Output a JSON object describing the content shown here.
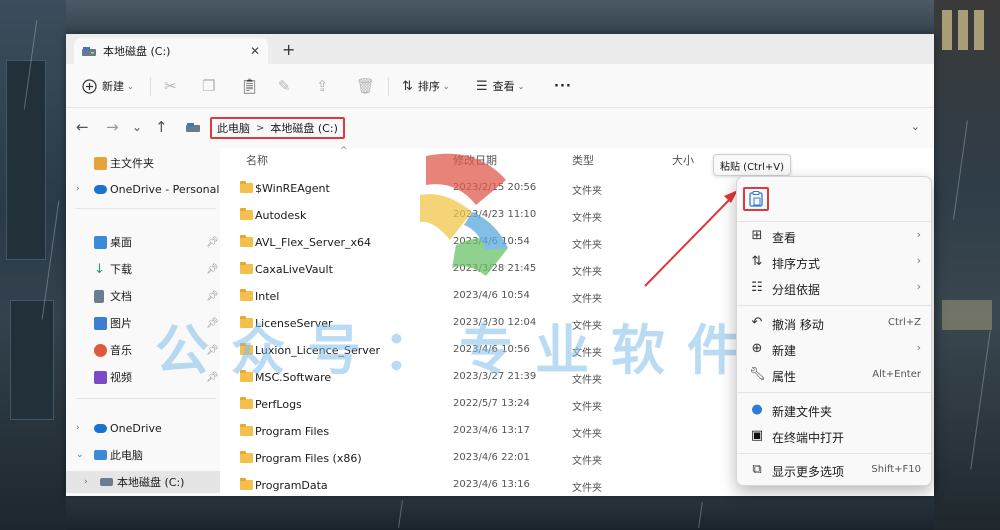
{
  "window": {
    "tab_title": "本地磁盘 (C:)",
    "tab_close": "✕",
    "new_tab": "+"
  },
  "toolbar": {
    "new_label": "新建",
    "sort_label": "排序",
    "view_label": "查看",
    "more": "···"
  },
  "address": {
    "crumbs": [
      "此电脑",
      "本地磁盘 (C:)"
    ],
    "sep": ">"
  },
  "sidebar": {
    "items": [
      {
        "label": "主文件夹",
        "icon": "home-icon",
        "color": "#e8a23a"
      },
      {
        "label": "OneDrive - Personal",
        "icon": "cloud-icon",
        "color": "#1a73d1"
      },
      {
        "label": "桌面",
        "icon": "desktop-icon",
        "color": "#3a8ad6"
      },
      {
        "label": "下载",
        "icon": "download-icon",
        "color": "#2a9a6a"
      },
      {
        "label": "文档",
        "icon": "document-icon",
        "color": "#6a7d90"
      },
      {
        "label": "图片",
        "icon": "picture-icon",
        "color": "#3c7fd0"
      },
      {
        "label": "音乐",
        "icon": "music-icon",
        "color": "#e0593b"
      },
      {
        "label": "视频",
        "icon": "video-icon",
        "color": "#7a4ac8"
      },
      {
        "label": "OneDrive",
        "icon": "cloud-icon",
        "color": "#1a73d1"
      },
      {
        "label": "此电脑",
        "icon": "computer-icon",
        "color": "#3a8ad6"
      },
      {
        "label": "本地磁盘 (C:)",
        "icon": "drive-icon",
        "color": "#6a7d90"
      }
    ]
  },
  "list": {
    "headers": {
      "name": "名称",
      "date": "修改日期",
      "type": "类型",
      "size": "大小"
    },
    "rows": [
      {
        "name": "$WinREAgent",
        "date": "2023/2/15 20:56",
        "type": "文件夹"
      },
      {
        "name": "Autodesk",
        "date": "2023/4/23 11:10",
        "type": "文件夹"
      },
      {
        "name": "AVL_Flex_Server_x64",
        "date": "2023/4/6 10:54",
        "type": "文件夹"
      },
      {
        "name": "CaxaLiveVault",
        "date": "2023/3/28 21:45",
        "type": "文件夹"
      },
      {
        "name": "Intel",
        "date": "2023/4/6 10:54",
        "type": "文件夹"
      },
      {
        "name": "LicenseServer",
        "date": "2023/3/30 12:04",
        "type": "文件夹"
      },
      {
        "name": "Luxion_Licence_Server",
        "date": "2023/4/6 10:56",
        "type": "文件夹"
      },
      {
        "name": "MSC.Software",
        "date": "2023/3/27 21:39",
        "type": "文件夹"
      },
      {
        "name": "PerfLogs",
        "date": "2022/5/7 13:24",
        "type": "文件夹"
      },
      {
        "name": "Program Files",
        "date": "2023/4/6 13:17",
        "type": "文件夹"
      },
      {
        "name": "Program Files (x86)",
        "date": "2023/4/6 22:01",
        "type": "文件夹"
      },
      {
        "name": "ProgramData",
        "date": "2023/4/6 13:16",
        "type": "文件夹"
      }
    ]
  },
  "tooltip": "粘贴 (Ctrl+V)",
  "context_menu": {
    "items": [
      {
        "label": "查看",
        "icon": "grid-icon",
        "shortcut": "",
        "submenu": true
      },
      {
        "label": "排序方式",
        "icon": "sort-icon",
        "shortcut": "",
        "submenu": true
      },
      {
        "label": "分组依据",
        "icon": "group-icon",
        "shortcut": "",
        "submenu": true
      },
      {
        "label": "撤消 移动",
        "icon": "undo-icon",
        "shortcut": "Ctrl+Z",
        "submenu": false
      },
      {
        "label": "新建",
        "icon": "new-icon",
        "shortcut": "",
        "submenu": true
      },
      {
        "label": "属性",
        "icon": "wrench-icon",
        "shortcut": "Alt+Enter",
        "submenu": false
      },
      {
        "label": "新建文件夹",
        "icon": "new-folder-icon",
        "shortcut": "",
        "submenu": false
      },
      {
        "label": "在终端中打开",
        "icon": "terminal-icon",
        "shortcut": "",
        "submenu": false
      },
      {
        "label": "显示更多选项",
        "icon": "more-options-icon",
        "shortcut": "Shift+F10",
        "submenu": false
      }
    ]
  },
  "watermark": "公众号：专业软件安装",
  "colors": {
    "highlight_red": "#e0383b",
    "folder_yellow": "#f4c04c",
    "accent_blue": "#1a73d1"
  }
}
